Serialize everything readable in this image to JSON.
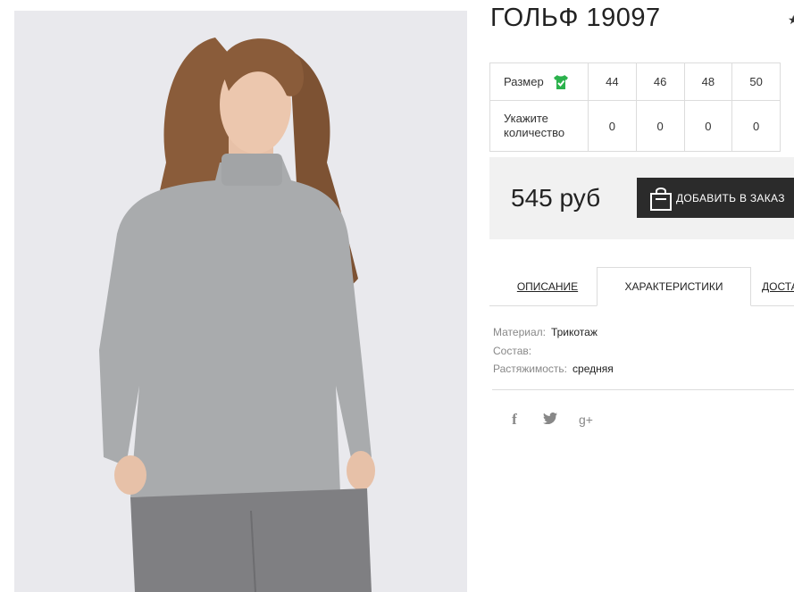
{
  "product": {
    "title": "ГОЛЬФ 19097",
    "favorite_icon": "star-icon"
  },
  "sizes": {
    "label": "Размер",
    "icon": "tshirt-check-icon",
    "values": [
      "44",
      "46",
      "48",
      "50"
    ]
  },
  "quantity": {
    "label_line1": "Укажите",
    "label_line2": "количество",
    "values": [
      "0",
      "0",
      "0",
      "0"
    ]
  },
  "purchase": {
    "price": "545 руб",
    "add_to_cart_label": "ДОБАВИТЬ В ЗАКАЗ",
    "icon": "shopping-bag-icon"
  },
  "tabs": [
    {
      "label": "ОПИСАНИЕ",
      "active": false
    },
    {
      "label": "ХАРАКТЕРИСТИКИ",
      "active": true
    },
    {
      "label": "ДОСТАВКА",
      "active": false
    }
  ],
  "characteristics": [
    {
      "key": "Материал:",
      "value": "Трикотаж"
    },
    {
      "key": "Состав:",
      "value": ""
    },
    {
      "key": "Растяжимость:",
      "value": "средняя"
    }
  ],
  "social": {
    "facebook": "f",
    "twitter": "twitter-icon",
    "googleplus": "g+"
  },
  "colors": {
    "button_bg": "#2b2b2b",
    "price_box_bg": "#f1f1f1",
    "size_icon": "#2bb24c",
    "sweater": "#a9abad"
  }
}
